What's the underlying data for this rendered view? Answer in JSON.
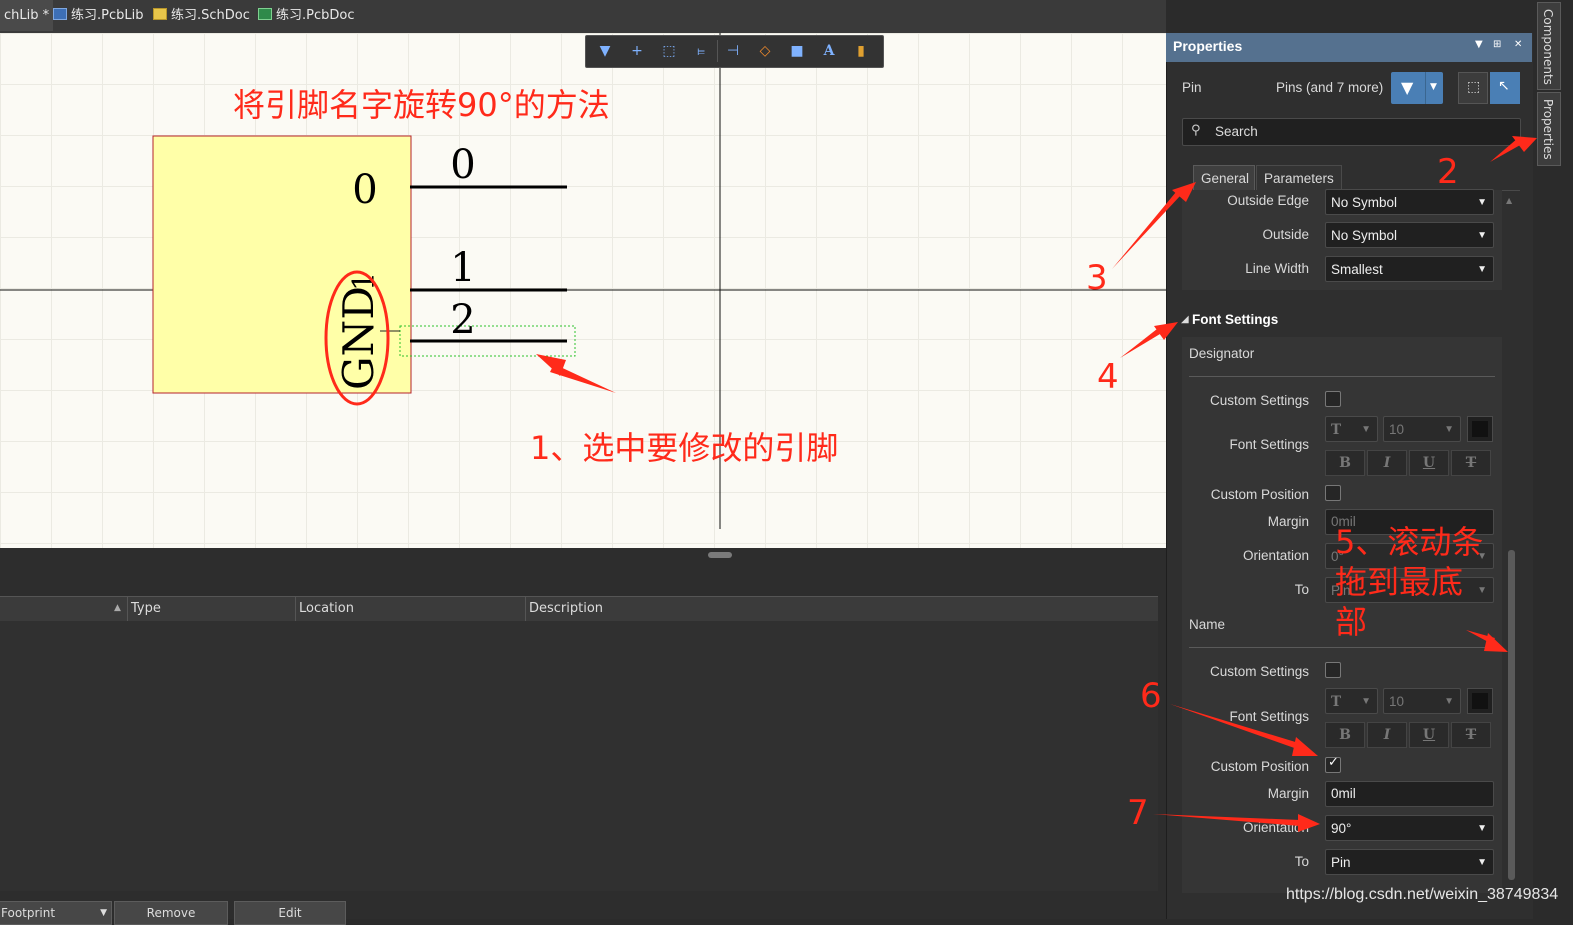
{
  "tabs": [
    {
      "label": "chLib *",
      "active": true
    },
    {
      "label": "练习.PcbLib",
      "icon": "pcblib-icon"
    },
    {
      "label": "练习.SchDoc",
      "icon": "schdoc-icon"
    },
    {
      "label": "练习.PcbDoc",
      "icon": "pcbdoc-icon"
    }
  ],
  "canvas": {
    "component": {
      "pin_numbers": [
        "0",
        "1",
        "2"
      ],
      "pin_name_top": "0",
      "pin_name_rotated": "GND",
      "pin_1_marker": "1"
    }
  },
  "toolbar": {
    "icons": [
      "filter-icon",
      "add-icon",
      "select-rect-icon",
      "align-icon",
      "pin-icon",
      "fill-icon",
      "rectangle-icon",
      "text-icon",
      "part-icon"
    ]
  },
  "messages": {
    "columns": [
      "Type",
      "Location",
      "Description"
    ]
  },
  "bottom_buttons": [
    "Footprint",
    "Remove",
    "Edit"
  ],
  "properties": {
    "title": "Properties",
    "object_type": "Pin",
    "selection": "Pins (and 7 more)",
    "search_placeholder": "Search",
    "tabs": [
      "General",
      "Parameters"
    ],
    "pin_props": [
      {
        "label": "Outside Edge",
        "value": "No Symbol"
      },
      {
        "label": "Outside",
        "value": "No Symbol"
      },
      {
        "label": "Line Width",
        "value": "Smallest"
      }
    ],
    "font_settings_header": "Font Settings",
    "designator": {
      "title": "Designator",
      "custom_settings_label": "Custom Settings",
      "font_settings_label": "Font Settings",
      "font_size": "10",
      "custom_position_label": "Custom Position",
      "margin_label": "Margin",
      "margin_value": "0mil",
      "orientation_label": "Orientation",
      "orientation_value": "0°",
      "to_label": "To",
      "to_value": "Pin"
    },
    "name": {
      "title": "Name",
      "custom_settings_label": "Custom Settings",
      "font_settings_label": "Font Settings",
      "font_size": "10",
      "custom_position_label": "Custom Position",
      "custom_position_checked": true,
      "margin_label": "Margin",
      "margin_value": "0mil",
      "orientation_label": "Orientation",
      "orientation_value": "90°",
      "to_label": "To",
      "to_value": "Pin"
    },
    "format_buttons": [
      "B",
      "I",
      "U",
      "T"
    ]
  },
  "side_tabs": [
    "Components",
    "Properties"
  ],
  "annotations": {
    "title": "将引脚名字旋转90°的方法",
    "step1": "1、选中要修改的引脚",
    "step2": "2",
    "step3": "3",
    "step4": "4",
    "step5_line1": "5、滚动条",
    "step5_line2": "拖到最底",
    "step5_line3": "部",
    "step6": "6",
    "step7": "7",
    "color": "#ff2a1a"
  },
  "watermark": "https://blog.csdn.net/weixin_38749834"
}
